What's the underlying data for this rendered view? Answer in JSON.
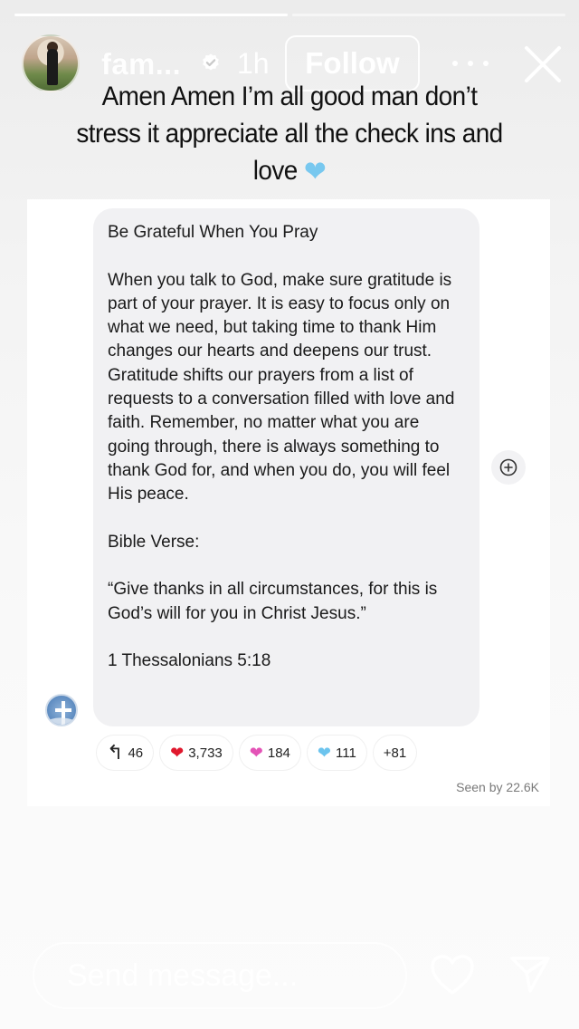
{
  "story": {
    "progress": [
      1.0,
      0.0
    ]
  },
  "header": {
    "username": "fam...",
    "time": "1h",
    "follow_label": "Follow"
  },
  "caption": {
    "text": "Amen Amen I’m all good man don’t stress it appreciate all the check ins and love",
    "emoji_icon": "light-blue-heart-icon"
  },
  "message": {
    "title": "Be Grateful When You Pray",
    "body": "When you talk to God, make sure gratitude is part of your prayer. It is easy to focus only on what we need, but taking time to thank Him changes our hearts and deepens our trust. Gratitude shifts our prayers from a list of requests to a conversation filled with love and faith. Remember, no matter what you are going through, there is always something to thank God for, and when you do, you will feel His peace.",
    "verse_label": "Bible Verse:",
    "verse_text": "“Give thanks in all circumstances, for this is God’s will for you in Christ Jesus.”",
    "verse_ref": "1 Thessalonians 5:18"
  },
  "reactions": [
    {
      "icon": "reply-arrow-icon",
      "glyph": "↰",
      "count": "46"
    },
    {
      "icon": "red-heart-icon",
      "glyph": "❤",
      "count": "3,733",
      "color": "#e0182d"
    },
    {
      "icon": "pink-heart-icon",
      "glyph": "❤",
      "count": "184",
      "color": "#e353b6"
    },
    {
      "icon": "light-blue-heart-icon",
      "glyph": "❤",
      "count": "111",
      "color": "#6cc4ee"
    },
    {
      "icon": "",
      "glyph": "",
      "count": "+81"
    }
  ],
  "seen": "Seen by 22.6K",
  "footer": {
    "placeholder": "Send message..."
  }
}
